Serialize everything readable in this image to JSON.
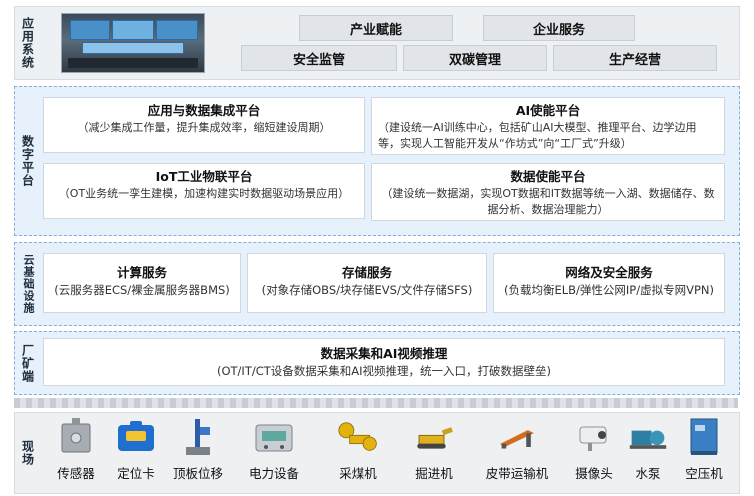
{
  "app_system": {
    "label": "应用系统",
    "buttons": [
      "产业赋能",
      "企业服务",
      "安全监管",
      "双碳管理",
      "生产经营"
    ]
  },
  "data_platform": {
    "label": "数字平台",
    "cards": [
      {
        "title": "应用与数据集成平台",
        "desc": "（减少集成工作量，提升集成效率，缩短建设周期）"
      },
      {
        "title": "AI使能平台",
        "desc": "（建设统一AI训练中心，包括矿山AI大模型、推理平台、边学边用等，实现人工智能开发从“作坊式”向“工厂式”升级）"
      },
      {
        "title": "IoT工业物联平台",
        "desc": "（OT业务统一孪生建模，加速构建实时数据驱动场景应用）"
      },
      {
        "title": "数据使能平台",
        "desc": "（建设统一数据湖，实现OT数据和IT数据等统一入湖、数据储存、数据分析、数据治理能力）"
      }
    ]
  },
  "cloud": {
    "label": "云基础设施",
    "cards": [
      {
        "title": "计算服务",
        "desc": "(云服务器ECS/裸金属服务器BMS)"
      },
      {
        "title": "存储服务",
        "desc": "(对象存储OBS/块存储EVS/文件存储SFS)"
      },
      {
        "title": "网络及安全服务",
        "desc": "(负载均衡ELB/弹性公网IP/虚拟专网VPN)"
      }
    ]
  },
  "factory": {
    "label": "厂矿端",
    "title": "数据采集和AI视频推理",
    "desc": "(OT/IT/CT设备数据采集和AI视频推理，统一入口，打破数据壁垒)"
  },
  "field": {
    "label": "现场",
    "devices": [
      {
        "name": "传感器",
        "icon": "sensor-icon"
      },
      {
        "name": "定位卡",
        "icon": "locator-card-icon"
      },
      {
        "name": "顶板位移",
        "icon": "roof-displacement-icon"
      },
      {
        "name": "电力设备",
        "icon": "power-equipment-icon"
      },
      {
        "name": "采煤机",
        "icon": "shearer-icon"
      },
      {
        "name": "掘进机",
        "icon": "roadheader-icon"
      },
      {
        "name": "皮带运输机",
        "icon": "belt-conveyor-icon"
      },
      {
        "name": "摄像头",
        "icon": "camera-icon"
      },
      {
        "name": "水泵",
        "icon": "water-pump-icon"
      },
      {
        "name": "空压机",
        "icon": "air-compressor-icon"
      }
    ]
  },
  "colors": {
    "band_blue": "#e7f1fb",
    "dash_blue": "#7fb0dd",
    "band_gray": "#eef1f4"
  }
}
